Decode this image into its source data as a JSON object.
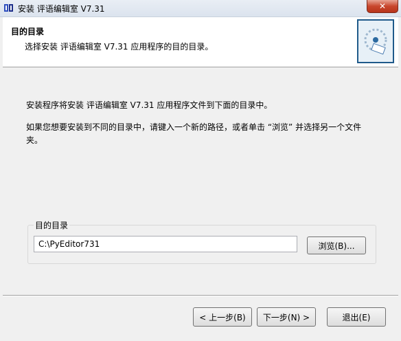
{
  "window": {
    "title": "安装 评语编辑室 V7.31",
    "close_label": "✕"
  },
  "header": {
    "title": "目的目录",
    "subtitle": "选择安装 评语编辑室 V7.31 应用程序的目的目录。"
  },
  "content": {
    "para1": "安装程序将安装 评语编辑室 V7.31 应用程序文件到下面的目录中。",
    "para2": "如果您想要安装到不同的目录中，请键入一个新的路径，或者单击 “浏览” 并选择另一个文件夹。"
  },
  "destination": {
    "group_label": "目的目录",
    "path_value": "C:\\PyEditor731",
    "browse_label": "浏览(B)..."
  },
  "footer": {
    "back_label": "< 上一步(B)",
    "next_label": "下一步(N) >",
    "exit_label": "退出(E)"
  }
}
